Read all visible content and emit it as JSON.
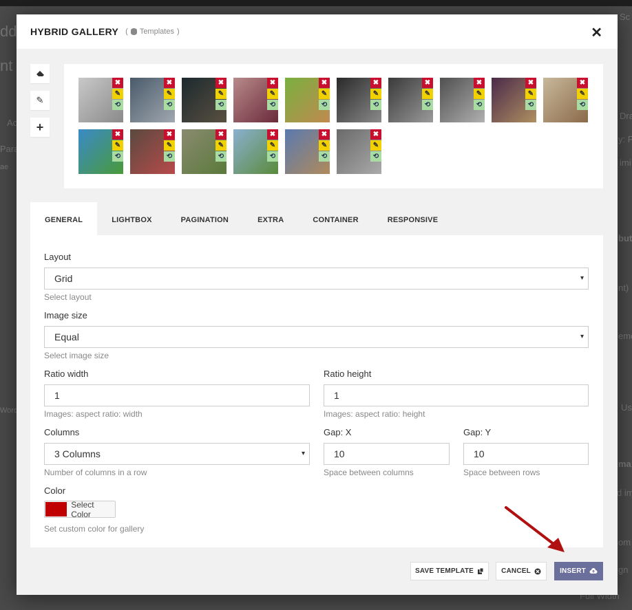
{
  "background": {
    "fragments": [
      "dd",
      "nt",
      "Ac",
      "Para",
      "ae",
      "Word",
      "Sc",
      "Dra",
      "y: P",
      "imi",
      "but",
      "nt)",
      "eme",
      "Us",
      "ma",
      "d im",
      "om",
      "gn",
      "Full Width"
    ]
  },
  "modal": {
    "title": "HYBRID GALLERY",
    "subtitle": "Templates",
    "close_icon": "close-icon"
  },
  "toolbar": {
    "eraser": "eraser-icon",
    "pencil": "pencil-icon",
    "add": "plus-icon",
    "pencil_glyph": "✎",
    "add_glyph": "+"
  },
  "gallery": {
    "control_glyphs": {
      "delete": "✖",
      "edit": "✎",
      "rotate": "⟲"
    },
    "images": [
      {
        "name": "image-girl-heart",
        "colors": [
          "#c8c8c8",
          "#8a8a8a"
        ]
      },
      {
        "name": "image-elephant-balloon",
        "colors": [
          "#4a5a6a",
          "#a0a8b0"
        ]
      },
      {
        "name": "image-food-plate",
        "colors": [
          "#1c2a2f",
          "#5a5040"
        ]
      },
      {
        "name": "image-girl-eating",
        "colors": [
          "#b88a8a",
          "#6a2a3a"
        ]
      },
      {
        "name": "image-man-burger",
        "colors": [
          "#7ab040",
          "#c08a50"
        ]
      },
      {
        "name": "image-horse-head",
        "colors": [
          "#2a2a2a",
          "#8a8a8a"
        ]
      },
      {
        "name": "image-jumping-cat",
        "colors": [
          "#3a3a3a",
          "#9a9a9a"
        ]
      },
      {
        "name": "image-eiffel-car",
        "colors": [
          "#505050",
          "#b0b0b0"
        ]
      },
      {
        "name": "image-fruit-tower",
        "colors": [
          "#4a2a4a",
          "#b09060"
        ]
      },
      {
        "name": "image-puppy-laptop",
        "colors": [
          "#c8b89a",
          "#8a6a4a"
        ]
      },
      {
        "name": "image-tiny-planet",
        "colors": [
          "#3a8ac8",
          "#4a9a3a"
        ]
      },
      {
        "name": "image-steak",
        "colors": [
          "#5a4a40",
          "#b84a4a"
        ]
      },
      {
        "name": "image-mountain-path",
        "colors": [
          "#8a8a70",
          "#5a7a3a"
        ]
      },
      {
        "name": "image-golfer",
        "colors": [
          "#8ab0d0",
          "#5a8a3a"
        ]
      },
      {
        "name": "image-open-road",
        "colors": [
          "#5a7ab0",
          "#b08a5a"
        ]
      },
      {
        "name": "image-heart-tag",
        "colors": [
          "#6a6a6a",
          "#aaaaaa"
        ]
      }
    ]
  },
  "tabs": [
    "GENERAL",
    "LIGHTBOX",
    "PAGINATION",
    "EXTRA",
    "CONTAINER",
    "RESPONSIVE"
  ],
  "form": {
    "layout": {
      "label": "Layout",
      "value": "Grid",
      "help": "Select layout"
    },
    "image_size": {
      "label": "Image size",
      "value": "Equal",
      "help": "Select image size"
    },
    "ratio_width": {
      "label": "Ratio width",
      "value": "1",
      "help": "Images: aspect ratio: width"
    },
    "ratio_height": {
      "label": "Ratio height",
      "value": "1",
      "help": "Images: aspect ratio: height"
    },
    "columns": {
      "label": "Columns",
      "value": "3 Columns",
      "help": "Number of columns in a row"
    },
    "gap_x": {
      "label": "Gap: X",
      "value": "10",
      "help": "Space between columns"
    },
    "gap_y": {
      "label": "Gap: Y",
      "value": "10",
      "help": "Space between rows"
    },
    "color": {
      "label": "Color",
      "button": "Select Color",
      "value": "#c00000",
      "help": "Set custom color for gallery"
    },
    "dropdown_caret": "▾"
  },
  "footer": {
    "save": "SAVE TEMPLATE",
    "cancel": "CANCEL",
    "insert": "INSERT"
  },
  "colors": {
    "accent": "#6b6f9c",
    "delete": "#c8102e",
    "edit": "#f2d100",
    "rotate": "#a8dca0",
    "arrow": "#b01010"
  }
}
